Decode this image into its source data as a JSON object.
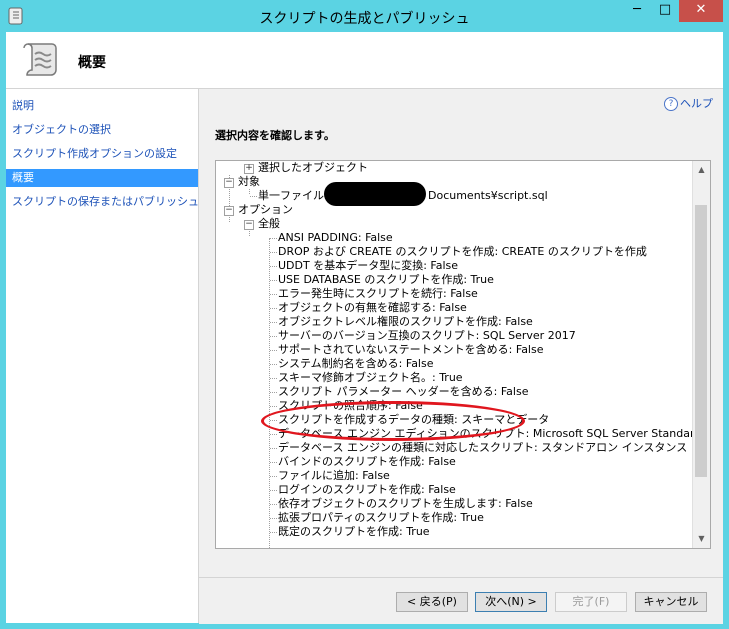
{
  "window": {
    "title": "スクリプトの生成とパブリッシュ",
    "minimize": "─",
    "maximize": "□",
    "close": "✕"
  },
  "header": {
    "title": "概要"
  },
  "sidebar": {
    "items": [
      {
        "label": "説明"
      },
      {
        "label": "オブジェクトの選択"
      },
      {
        "label": "スクリプト作成オプションの設定"
      },
      {
        "label": "概要",
        "active": true
      },
      {
        "label": "スクリプトの保存またはパブリッシュ"
      }
    ]
  },
  "main": {
    "help": "ヘルプ",
    "prompt": "選択内容を確認します。",
    "tree": [
      {
        "text": "選択したオブジェクト"
      },
      {
        "text": "対象"
      },
      {
        "text_prefix": "単一ファイル: C",
        "text_suffix": "Documents¥script.sql"
      },
      {
        "text": "オプション"
      },
      {
        "text": "全般"
      },
      {
        "text": "ANSI PADDING: False"
      },
      {
        "text": "DROP および CREATE のスクリプトを作成: CREATE のスクリプトを作成"
      },
      {
        "text": "UDDT を基本データ型に変換: False"
      },
      {
        "text": "USE DATABASE のスクリプトを作成: True"
      },
      {
        "text": "エラー発生時にスクリプトを続行: False"
      },
      {
        "text": "オブジェクトの有無を確認する: False"
      },
      {
        "text": "オブジェクトレベル権限のスクリプトを作成: False"
      },
      {
        "text": "サーバーのバージョン互換のスクリプト: SQL Server 2017"
      },
      {
        "text": "サポートされていないステートメントを含める: False"
      },
      {
        "text": "システム制約名を含める: False"
      },
      {
        "text": "スキーマ修飾オブジェクト名。: True"
      },
      {
        "text": "スクリプト パラメーター ヘッダーを含める: False"
      },
      {
        "text": "スクリプトの照合順序: False"
      },
      {
        "text": "スクリプトを作成するデータの種類: スキーマとデータ"
      },
      {
        "text": "データベース エンジン エディションのスクリプト: Microsoft SQL Server Standard Edition"
      },
      {
        "text": "データベース エンジンの種類に対応したスクリプト: スタンドアロン インスタンス"
      },
      {
        "text": "バインドのスクリプトを作成: False"
      },
      {
        "text": "ファイルに追加: False"
      },
      {
        "text": "ログインのスクリプトを作成: False"
      },
      {
        "text": "依存オブジェクトのスクリプトを生成します: False"
      },
      {
        "text": "拡張プロパティのスクリプトを作成: True"
      },
      {
        "text": "既定のスクリプトを作成: True"
      }
    ]
  },
  "footer": {
    "back": "< 戻る(P)",
    "next": "次へ(N) >",
    "finish": "完了(F)",
    "cancel": "キャンセル"
  }
}
